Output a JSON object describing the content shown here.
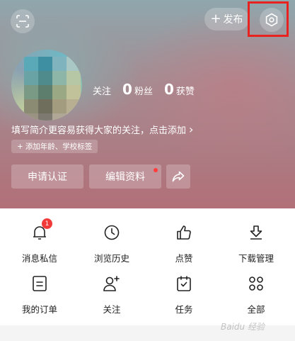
{
  "header": {
    "publish_label": "发布",
    "publish_plus": "+",
    "stats": [
      {
        "number": "",
        "label": "关注"
      },
      {
        "number": "0",
        "label": "粉丝"
      },
      {
        "number": "0",
        "label": "获赞"
      }
    ],
    "bio_text": "填写简介更容易获得大家的关注，点击添加",
    "bio_chevron": "›",
    "tag_chip_label": "添加年龄、学校标签",
    "tag_chip_plus": "+",
    "verify_button": "申请认证",
    "edit_profile_button": "编辑资料"
  },
  "grid": [
    {
      "label": "消息私信",
      "icon": "bell-icon",
      "badge": "1"
    },
    {
      "label": "浏览历史",
      "icon": "clock-icon"
    },
    {
      "label": "点赞",
      "icon": "thumbs-up-icon"
    },
    {
      "label": "下载管理",
      "icon": "download-icon"
    },
    {
      "label": "我的订单",
      "icon": "order-icon"
    },
    {
      "label": "关注",
      "icon": "add-user-icon"
    },
    {
      "label": "任务",
      "icon": "task-calendar-icon"
    },
    {
      "label": "全部",
      "icon": "all-grid-icon"
    }
  ],
  "watermark": "Baidu 经验",
  "colors": {
    "highlight_box": "#e8231f",
    "badge": "#f23a3a",
    "edit_dot": "#ff3b3b"
  }
}
